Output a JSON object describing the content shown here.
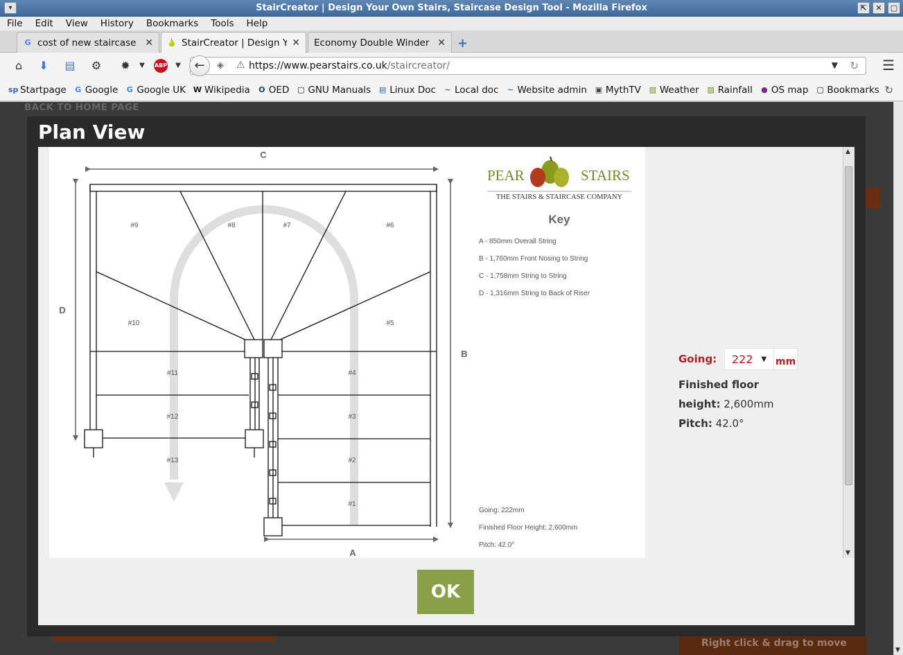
{
  "window": {
    "title": "StairCreator | Design Your Own Stairs, Staircase Design Tool - Mozilla Firefox",
    "menu_glyph": "▾",
    "buttons": [
      "⇱",
      "✕",
      "▢"
    ]
  },
  "menubar": [
    "File",
    "Edit",
    "View",
    "History",
    "Bookmarks",
    "Tools",
    "Help"
  ],
  "tabs": [
    {
      "favicon": "G",
      "title": "cost of new staircase in u",
      "close": "✕",
      "active": false
    },
    {
      "favicon": "🍐",
      "title": "StairCreator | Design Your",
      "close": "✕",
      "active": true
    },
    {
      "favicon": "",
      "title": "Economy Double Winder St",
      "close": "✕",
      "active": false
    }
  ],
  "newtab": "+",
  "navbar": {
    "url_host": "https://www.pearstairs.co.uk",
    "url_path": "/staircreator/",
    "back": "←",
    "reload": "↻"
  },
  "bookmarks": [
    {
      "icon": "sp",
      "label": "Startpage"
    },
    {
      "icon": "G",
      "label": "Google"
    },
    {
      "icon": "G",
      "label": "Google UK"
    },
    {
      "icon": "W",
      "label": "Wikipedia"
    },
    {
      "icon": "O",
      "label": "OED"
    },
    {
      "icon": "▢",
      "label": "GNU Manuals"
    },
    {
      "icon": "▤",
      "label": "Linux Doc"
    },
    {
      "icon": "~",
      "label": "Local doc"
    },
    {
      "icon": "~",
      "label": "Website admin"
    },
    {
      "icon": "▣",
      "label": "MythTV"
    },
    {
      "icon": "▨",
      "label": "Weather"
    },
    {
      "icon": "▨",
      "label": "Rainfall"
    },
    {
      "icon": "●",
      "label": "OS map"
    },
    {
      "icon": "▢",
      "label": "Bookmarks"
    }
  ],
  "page": {
    "back_home": "BACK TO HOME PAGE",
    "drag_hint": "Right click & drag to move"
  },
  "modal": {
    "title": "Plan View",
    "ok_label": "OK"
  },
  "plan": {
    "dim_labels": {
      "a": "A",
      "b": "B",
      "c": "C",
      "d": "D"
    },
    "treads": [
      "#1",
      "#2",
      "#3",
      "#4",
      "#5",
      "#6",
      "#7",
      "#8",
      "#9",
      "#10",
      "#11",
      "#12",
      "#13"
    ],
    "logo": {
      "left": "PEAR",
      "right": "STAIRS",
      "tagline": "THE STAIRS & STAIRCASE COMPANY"
    },
    "key_title": "Key",
    "key_items": [
      "A - 850mm Overall String",
      "B - 1,760mm Front Nosing to String",
      "C - 1,758mm String to String",
      "D - 1,316mm String to Back of Riser"
    ],
    "summary": [
      "Going: 222mm",
      "Finished Floor Height: 2,600mm",
      "Pitch: 42.0°"
    ]
  },
  "controls": {
    "going_label": "Going:",
    "going_value": "222",
    "going_unit": "mm",
    "floor_label_1": "Finished floor",
    "floor_label_2": "height:",
    "floor_value": "2,600mm",
    "pitch_label": "Pitch:",
    "pitch_value": "42.0°"
  },
  "colors": {
    "accent_red": "#b01d22",
    "ok_green": "#8aa048",
    "logo_green": "#6e8a2c"
  }
}
